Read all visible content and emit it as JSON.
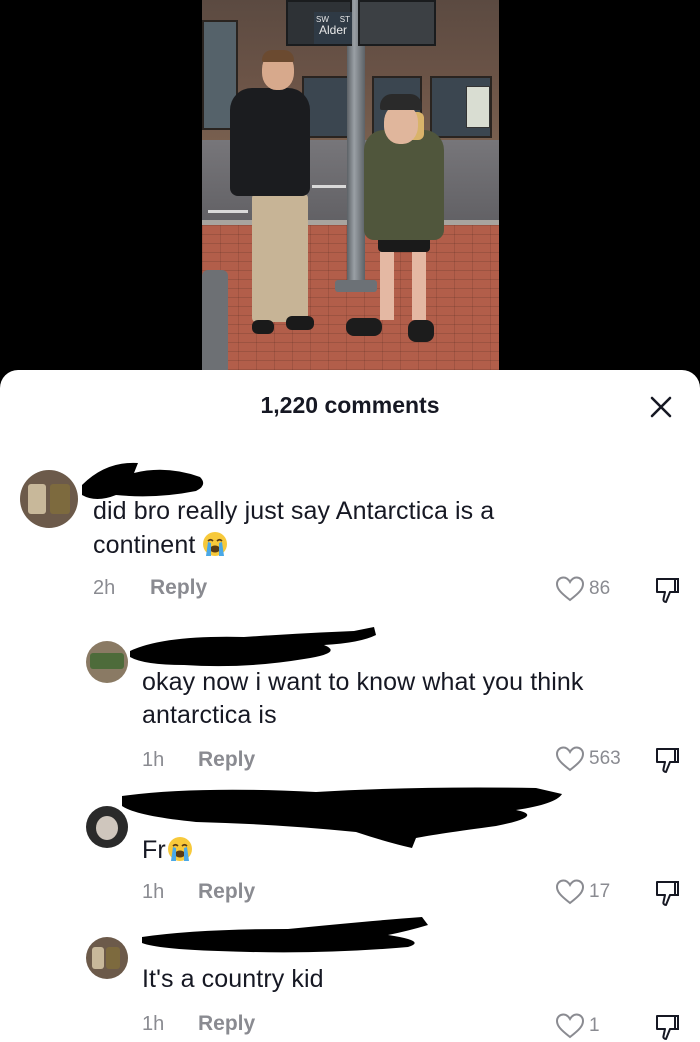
{
  "video": {
    "sign_text_top": "SW",
    "sign_text_right": "ST",
    "sign_street": "Alder"
  },
  "sheet": {
    "comment_count": "1,220 comments"
  },
  "comments": [
    {
      "text_line1": "did bro really just say Antarctica is a",
      "text_line2": "continent",
      "emoji": "loudly-crying-face",
      "time": "2h",
      "reply_label": "Reply",
      "likes": "86"
    },
    {
      "text_line1": "okay now i want to know what you think",
      "text_line2": "antarctica is",
      "time": "1h",
      "reply_label": "Reply",
      "likes": "563"
    },
    {
      "text_line1": "Fr",
      "emoji": "loudly-crying-face",
      "time": "1h",
      "reply_label": "Reply",
      "likes": "17"
    },
    {
      "text_line1": "It's a country kid",
      "time": "1h",
      "reply_label": "Reply",
      "likes": "1"
    }
  ],
  "colors": {
    "text": "#161823",
    "muted": "#8a8b91",
    "sheet_bg": "#ffffff",
    "video_bg": "#000000"
  }
}
